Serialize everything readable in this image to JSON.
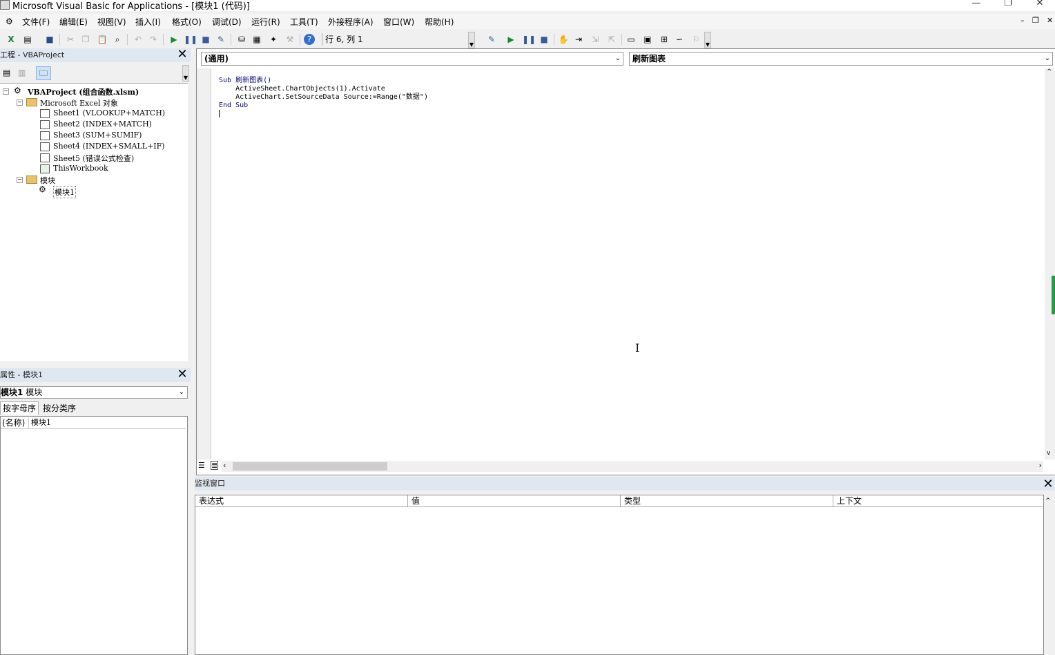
{
  "window": {
    "title": "Microsoft Visual Basic for Applications - [模块1 (代码)]",
    "minimize": "—",
    "restore": "❐",
    "close": "✕"
  },
  "menubar": {
    "items": [
      "文件(F)",
      "编辑(E)",
      "视图(V)",
      "插入(I)",
      "格式(O)",
      "调试(D)",
      "运行(R)",
      "工具(T)",
      "外接程序(A)",
      "窗口(W)",
      "帮助(H)"
    ],
    "mdi_minimize": "–",
    "mdi_restore": "❐",
    "mdi_close": "✕"
  },
  "toolbar": {
    "position": "行 6, 列 1"
  },
  "project_panel": {
    "title": "工程 - VBAProject",
    "root": "VBAProject (组合函数.xlsm)",
    "folder_excel": "Microsoft Excel 对象",
    "sheets": [
      "Sheet1 (VLOOKUP+MATCH)",
      "Sheet2 (INDEX+MATCH)",
      "Sheet3 (SUM+SUMIF)",
      "Sheet4 (INDEX+SMALL+IF)",
      "Sheet5 (错误公式检查)",
      "ThisWorkbook"
    ],
    "folder_modules": "模块",
    "module": "模块1"
  },
  "props_panel": {
    "title": "属性 - 模块1",
    "object": "模块1 模块",
    "object_name": "模块1",
    "object_type": "模块",
    "tab_alpha": "按字母序",
    "tab_category": "按分类序",
    "prop_name": "(名称)",
    "prop_value": "模块1"
  },
  "code_window": {
    "object_combo": "(通用)",
    "proc_combo": "刷新图表",
    "lines": [
      "Sub 刷新图表()",
      "    ActiveSheet.ChartObjects(1).Activate",
      "    ActiveChart.SetSourceData Source:=Range(\"数据\")",
      "End Sub"
    ]
  },
  "watch_panel": {
    "title": "监视窗口",
    "columns": [
      "表达式",
      "值",
      "类型",
      "上下文"
    ]
  }
}
